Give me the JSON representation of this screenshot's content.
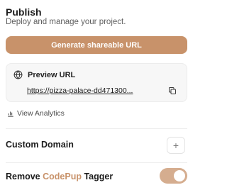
{
  "header": {
    "title": "Publish",
    "subtitle": "Deploy and manage your project."
  },
  "generate_button": {
    "label": "Generate shareable URL"
  },
  "preview": {
    "label": "Preview URL",
    "url": "https://pizza-palace-dd471300...",
    "icon": "globe-icon",
    "copy_icon": "copy-icon"
  },
  "analytics": {
    "label": "View Analytics",
    "icon": "bar-chart-icon"
  },
  "custom_domain": {
    "label": "Custom Domain",
    "add_symbol": "+"
  },
  "tagger": {
    "prefix": "Remove ",
    "brand": "CodePup",
    "suffix": " Tagger",
    "enabled": true
  },
  "colors": {
    "accent": "#c8926a",
    "card_bg": "#f7f7f7",
    "muted_text": "#5f5f5f"
  }
}
